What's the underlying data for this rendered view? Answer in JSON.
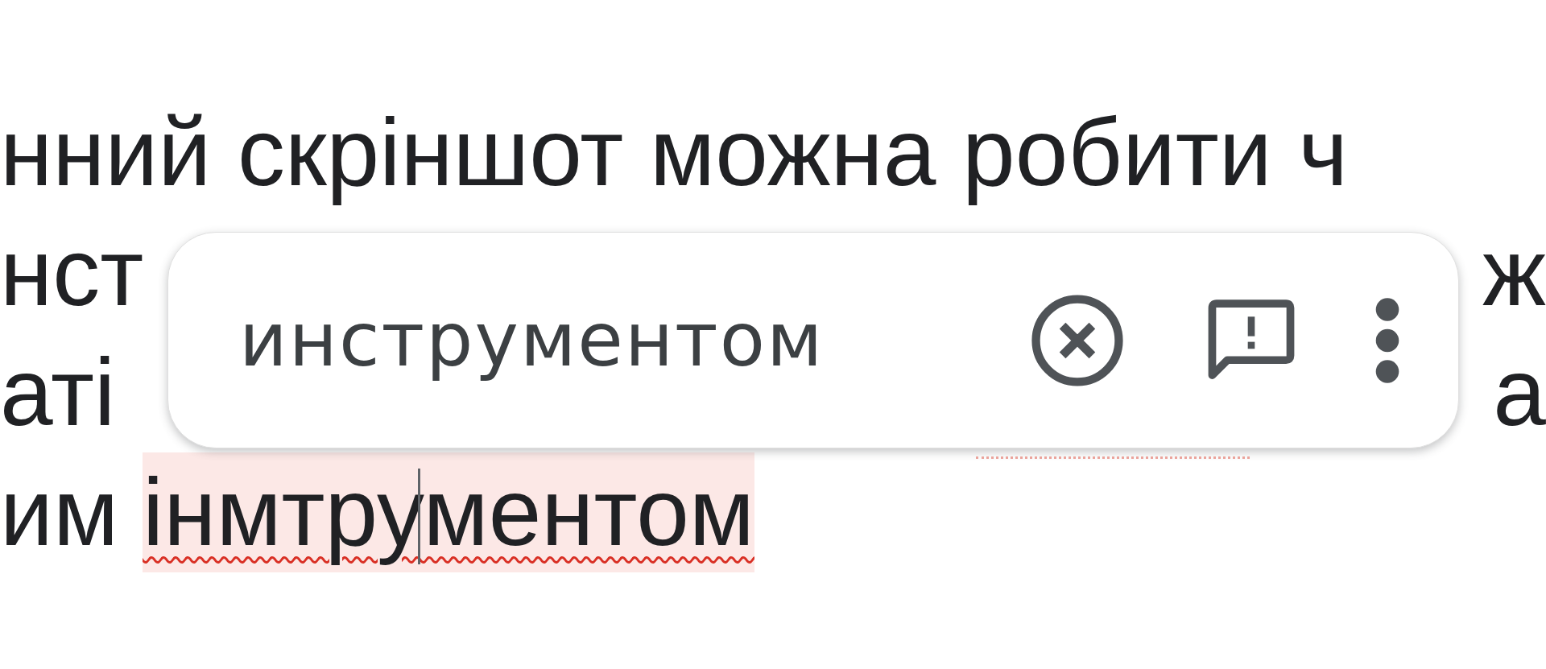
{
  "document": {
    "lines": [
      {
        "left": "нний скріншот можна робити ч"
      },
      {
        "left": "нст",
        "right": "ж"
      },
      {
        "left": "аті",
        "right": "а"
      },
      {
        "left": "им",
        "misspelled": "інмтрументом"
      }
    ]
  },
  "suggestion_popup": {
    "suggestion": "инструментом"
  }
}
